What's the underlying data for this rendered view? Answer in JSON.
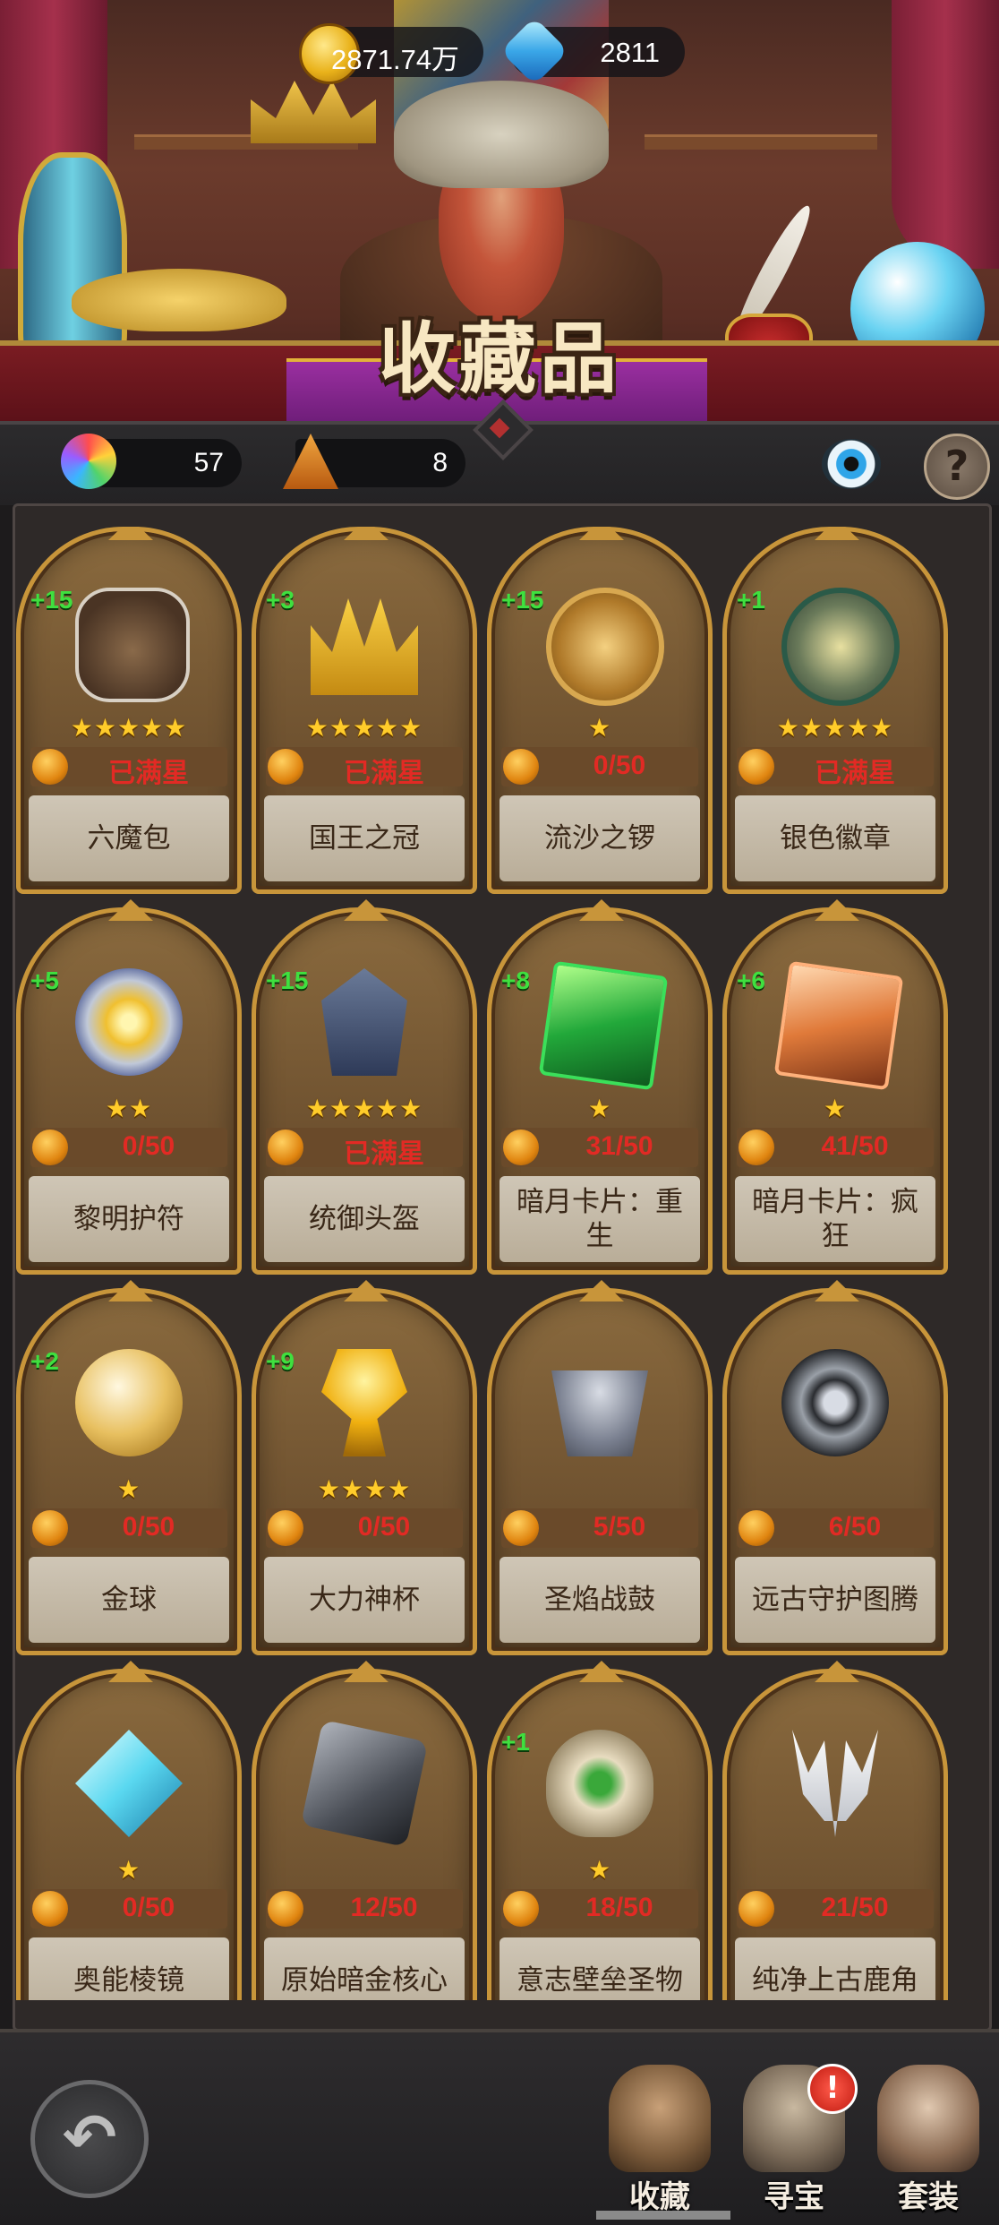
{
  "header": {
    "title": "收藏品",
    "gold": "2871.74万",
    "gems": "2811"
  },
  "stats": {
    "essence_count": "57",
    "sand_count": "8"
  },
  "icons": {
    "gold": "gold-coin-icon",
    "gem": "blue-gem-icon",
    "essence": "rainbow-essence-icon",
    "sand": "sand-pile-icon",
    "view": "eye-icon",
    "help": "question-icon",
    "back": "back-arrow-icon"
  },
  "help_glyph": "?",
  "back_glyph": "↶",
  "alert_glyph": "!",
  "items": [
    {
      "name": "六魔包",
      "bonus": "+15",
      "stars": "★★★★★",
      "progress": "已满星",
      "art": "a-bag"
    },
    {
      "name": "国王之冠",
      "bonus": "+3",
      "stars": "★★★★★",
      "progress": "已满星",
      "art": "a-crown"
    },
    {
      "name": "流沙之锣",
      "bonus": "+15",
      "stars": "★",
      "progress": "0/50",
      "art": "a-gong"
    },
    {
      "name": "银色徽章",
      "bonus": "+1",
      "stars": "★★★★★",
      "progress": "已满星",
      "art": "a-badge"
    },
    {
      "name": "黎明护符",
      "bonus": "+5",
      "stars": "★★",
      "progress": "0/50",
      "art": "a-charm"
    },
    {
      "name": "统御头盔",
      "bonus": "+15",
      "stars": "★★★★★",
      "progress": "已满星",
      "art": "a-helm"
    },
    {
      "name": "暗月卡片：重生",
      "bonus": "+8",
      "stars": "★",
      "progress": "31/50",
      "art": "a-card-g"
    },
    {
      "name": "暗月卡片：疯狂",
      "bonus": "+6",
      "stars": "★",
      "progress": "41/50",
      "art": "a-card-o"
    },
    {
      "name": "金球",
      "bonus": "+2",
      "stars": "★",
      "progress": "0/50",
      "art": "a-ball"
    },
    {
      "name": "大力神杯",
      "bonus": "+9",
      "stars": "★★★★",
      "progress": "0/50",
      "art": "a-cup"
    },
    {
      "name": "圣焰战鼓",
      "bonus": "",
      "stars": "",
      "progress": "5/50",
      "art": "a-drum"
    },
    {
      "name": "远古守护图腾",
      "bonus": "",
      "stars": "",
      "progress": "6/50",
      "art": "a-totem"
    },
    {
      "name": "奥能棱镜",
      "bonus": "",
      "stars": "★",
      "progress": "0/50",
      "art": "a-prism"
    },
    {
      "name": "原始暗金核心",
      "bonus": "",
      "stars": "",
      "progress": "12/50",
      "art": "a-cube"
    },
    {
      "name": "意志壁垒圣物",
      "bonus": "+1",
      "stars": "★",
      "progress": "18/50",
      "art": "a-relic"
    },
    {
      "name": "纯净上古鹿角",
      "bonus": "",
      "stars": "",
      "progress": "21/50",
      "art": "a-antler"
    }
  ],
  "nav": {
    "collect": "收藏",
    "hunt": "寻宝",
    "set": "套装",
    "active": "collect"
  },
  "colors": {
    "bonus": "#3fe03f",
    "progress": "#e22a24",
    "stars": "#ffcc2a",
    "frame": "#c8953a"
  }
}
